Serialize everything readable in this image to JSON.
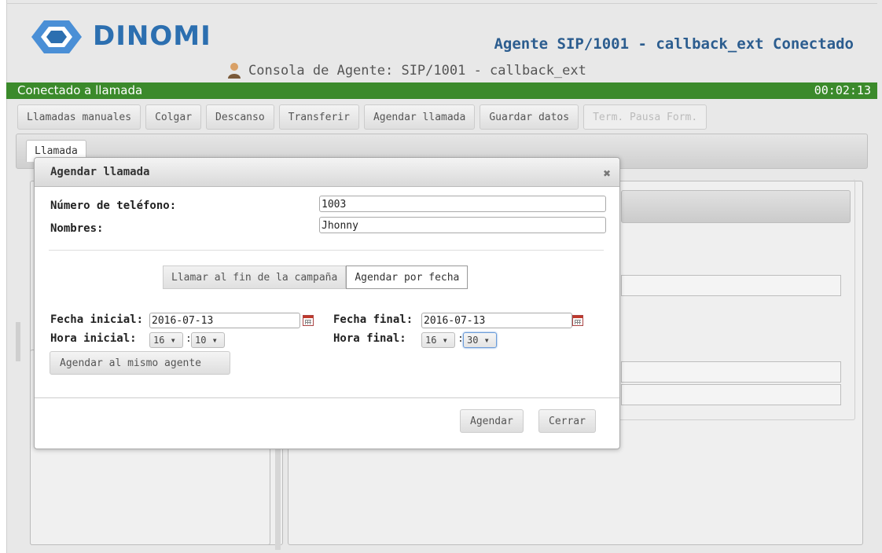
{
  "header": {
    "logo_text": "DINOMI",
    "agent_title": "Agente SIP/1001 - callback_ext Conectado",
    "console_title": "Consola de Agente: SIP/1001 - callback_ext"
  },
  "status_bar": {
    "text": "Conectado a llamada",
    "timer": "00:02:13",
    "color": "#3b8a2b"
  },
  "toolbar": {
    "buttons": [
      {
        "label": "Llamadas manuales",
        "enabled": true
      },
      {
        "label": "Colgar",
        "enabled": true
      },
      {
        "label": "Descanso",
        "enabled": true
      },
      {
        "label": "Transferir",
        "enabled": true
      },
      {
        "label": "Agendar llamada",
        "enabled": true
      },
      {
        "label": "Guardar datos",
        "enabled": true
      },
      {
        "label": "Term. Pausa Form.",
        "enabled": false
      }
    ]
  },
  "tabs": [
    {
      "label": "Llamada"
    }
  ],
  "modal": {
    "title": "Agendar llamada",
    "phone_label": "Número de teléfono:",
    "phone_value": "1003",
    "names_label": "Nombres:",
    "names_value": "Jhonny",
    "mode_options": [
      {
        "label": "Llamar al fin de la campaña",
        "selected": false
      },
      {
        "label": "Agendar por fecha",
        "selected": true
      }
    ],
    "start_date_label": "Fecha inicial:",
    "start_date_value": "2016-07-13",
    "end_date_label": "Fecha final:",
    "end_date_value": "2016-07-13",
    "start_time_label": "Hora inicial:",
    "start_hour": "16",
    "start_minute": "10",
    "end_time_label": "Hora final:",
    "end_hour": "16",
    "end_minute": "30",
    "same_agent_button": "Agendar al mismo agente",
    "schedule_button": "Agendar",
    "close_button": "Cerrar"
  }
}
